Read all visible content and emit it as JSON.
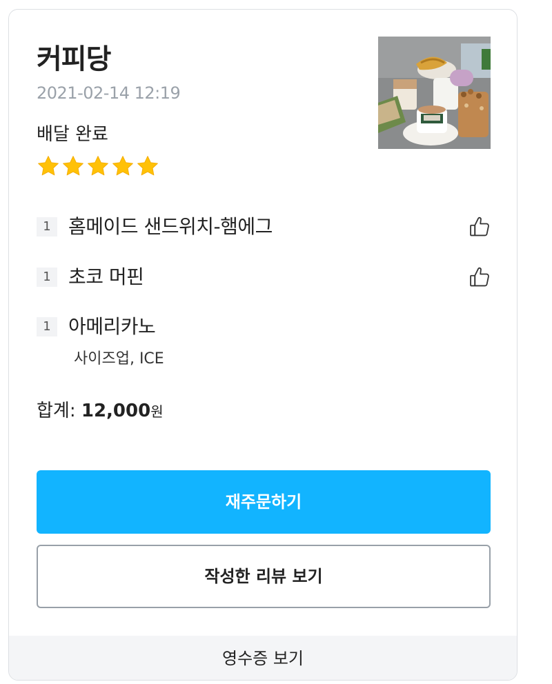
{
  "store": {
    "name": "커피당",
    "order_datetime": "2021-02-14 12:19",
    "status": "배달 완료",
    "rating": 5,
    "rating_max": 5,
    "star_color": "#ffc107"
  },
  "items": [
    {
      "qty": "1",
      "name": "홈메이드 샌드위치-햄에그",
      "options": "",
      "icon": "thumbs-up-icon"
    },
    {
      "qty": "1",
      "name": "초코 머핀",
      "options": "",
      "icon": "thumbs-up-icon"
    },
    {
      "qty": "1",
      "name": "아메리카노",
      "options": "사이즈업, ICE"
    }
  ],
  "total": {
    "label": "합계: ",
    "amount": "12,000",
    "unit": "원"
  },
  "actions": {
    "reorder_label": "재주문하기",
    "reorder_color": "#12b4ff",
    "review_label": "작성한 리뷰 보기",
    "receipt_label": "영수증 보기"
  }
}
